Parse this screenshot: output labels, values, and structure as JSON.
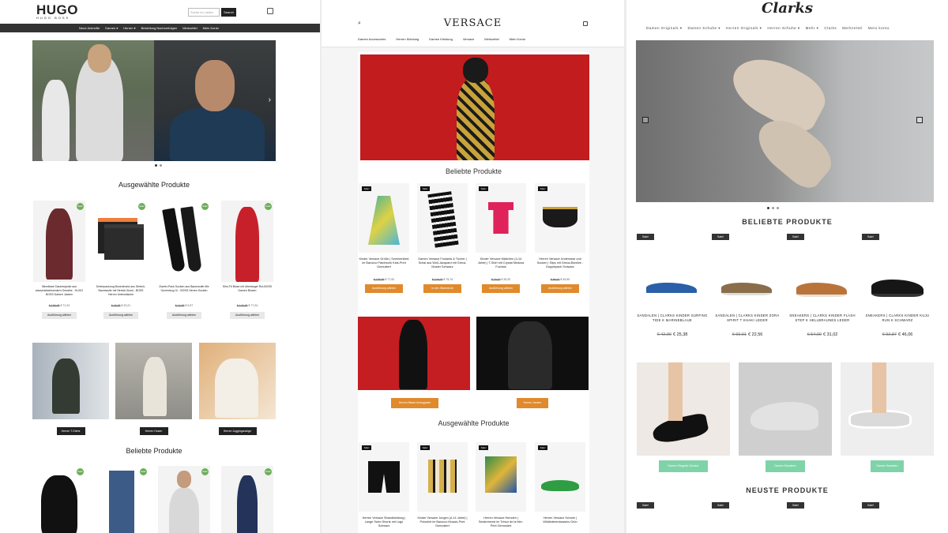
{
  "hugo": {
    "logo": "HUGO",
    "logo_sub": "HUGO BOSS",
    "search_placeholder": "Suche im Laden",
    "search_button": "Search",
    "nav": [
      "Neue Ankünfte",
      "Damen ▾",
      "Herren ▾",
      "Bestellung Nachverfolgen",
      "Merkzettel",
      "Mein Konto"
    ],
    "featured_title": "Ausgewählte Produkte",
    "products": [
      {
        "name": "Wendbare Daunenjacke aus wasserabweisendem Gewebe - HUGO BOSS Damen Jacken",
        "old": "€ 199,95",
        "price": "€ 71,24",
        "button": "Ausführung wählen",
        "badge": "Sale!",
        "color": "#6b2a2e"
      },
      {
        "name": "Dreierpackung Boxershorts aus Stretch-Baumwolle mit Stretch-Bund - BOSS Herren Unterwäsche",
        "old": "€ 49,95",
        "price": "€ 23,21",
        "button": "Ausführung wählen",
        "badge": "Sale!",
        "color": "#222"
      },
      {
        "name": "Zweier-Pack Socken aus Baumwolle Mix Gummizug Gr - BOSS Herren Socken",
        "old": "€ 19,95",
        "price": "€ 9,97",
        "button": "Ausführung wählen",
        "badge": "Sale!",
        "color": "#1a1a1a"
      },
      {
        "name": "Slim-Fit Bluse mit überlanger Rot-BOSS Damen Blusen",
        "old": "€ 149,95",
        "price": "€ 77,24",
        "button": "Ausführung wählen",
        "badge": "Sale!",
        "color": "#c8202a"
      }
    ],
    "categories": [
      {
        "label": "Herren T-Shirts"
      },
      {
        "label": "Herren Hosen"
      },
      {
        "label": "Herren Jogginganzüge"
      }
    ],
    "popular_title": "Beliebte Produkte",
    "popular_badges": [
      "Sale!",
      "Sale!",
      "Sale!",
      "Sale!"
    ]
  },
  "versace": {
    "logo": "VERSACE",
    "nav": [
      "Damen Accessoires",
      "Herren Kleidung",
      "Damen Kleidung",
      "Versace",
      "Merkzettel",
      "Mein Konto"
    ],
    "popular_title": "Beliebte Produkte",
    "popular": [
      {
        "name": "Kinder Versace Größe | Sommerkleid im Barocco Patchwork Kids-Print Gemustert",
        "old": "€ 159,95",
        "price": "€ 77,00",
        "button": "Ausführung wählen",
        "badge": "Sale!"
      },
      {
        "name": "Damen Versace Foulards & Tücher | Schal aus Woll-Jacquard mit Greca-Muster Schwarz",
        "old": "€ 149,00",
        "price": "€ 75,74",
        "button": "In den Warenkorb",
        "badge": "Sale!"
      },
      {
        "name": "Kinder Versace Mädchen (4-14 Jahre) | T-Shirt mit Crystal Medusa Fuchsia",
        "old": "€ 79,00",
        "price": "€ 39,20",
        "button": "Ausführung wählen",
        "badge": "Sale!"
      },
      {
        "name": "Herren Versace Underwear und Socken | Slips mit Greca-Bordüre - Doppelpack Schwarz",
        "old": "€ 99,00",
        "price": "€ 49,90",
        "button": "Ausführung wählen",
        "badge": "Sale!"
      }
    ],
    "banners": [
      {
        "button": "Herren Blazer Anzugjacke"
      },
      {
        "button": "Herren Jacken"
      }
    ],
    "featured_title": "Ausgewählte Produkte",
    "featured": [
      {
        "name": "Herren Versace Strandkleidung | Lange Swim Shorts mit Logo Schwarz",
        "badge": "Sale!"
      },
      {
        "name": "Kinder Versace Jungen (4-14 Jahre) | Poloshirt im Barocco Mosaic-Print Gemustert",
        "badge": "Sale!"
      },
      {
        "name": "Herren Versace Hemden | Seidenhemd im Trésor de la Mer-Print Gemustert",
        "badge": "Sale!"
      },
      {
        "name": "Herren Versace Schuhe | Wildledermokassins Grün",
        "badge": "Sale!"
      }
    ]
  },
  "clarks": {
    "logo": "Clarks",
    "nav": [
      "Damen Originals ▾",
      "Damen Schuhe ▾",
      "Herren Originals ▾",
      "Herren Schuhe ▾",
      "Mehr ▾",
      "Clarks",
      "Merkzettel",
      "Mein konto"
    ],
    "popular_title": "BELIEBTE PRODUKTE",
    "popular": [
      {
        "name": "SANDALEN | CLARKS KINDER SURFING TIDE K MARINEBLAUE",
        "old": "€ 42,90",
        "price": "€ 25,38",
        "badge": "Sale!"
      },
      {
        "name": "SANDALEN | CLARKS KINDER ZORA SPIRIT T KHAKI LEDER",
        "old": "€ 69,91",
        "price": "€ 22,56",
        "badge": "Sale!"
      },
      {
        "name": "SNEAKERS | CLARKS KINDER FLASH STEP K HELLBRAUNES LEDER",
        "old": "€ 54,90",
        "price": "€ 31,02",
        "badge": "Sale!"
      },
      {
        "name": "SNEAKERS | CLARKS KINDER KUJU RUN K SCHWARZ",
        "old": "€ 92,87",
        "price": "€ 46,06",
        "badge": "Sale!"
      }
    ],
    "banners": [
      {
        "button": "Damen Elegante Schuhe"
      },
      {
        "button": "Damen Sneakers"
      },
      {
        "button": "Damen Sandalen"
      }
    ],
    "new_title": "NEUSTE PRODUKTE",
    "new_badges": [
      "Sale!",
      "Sale!",
      "Sale!",
      "Sale!"
    ]
  }
}
